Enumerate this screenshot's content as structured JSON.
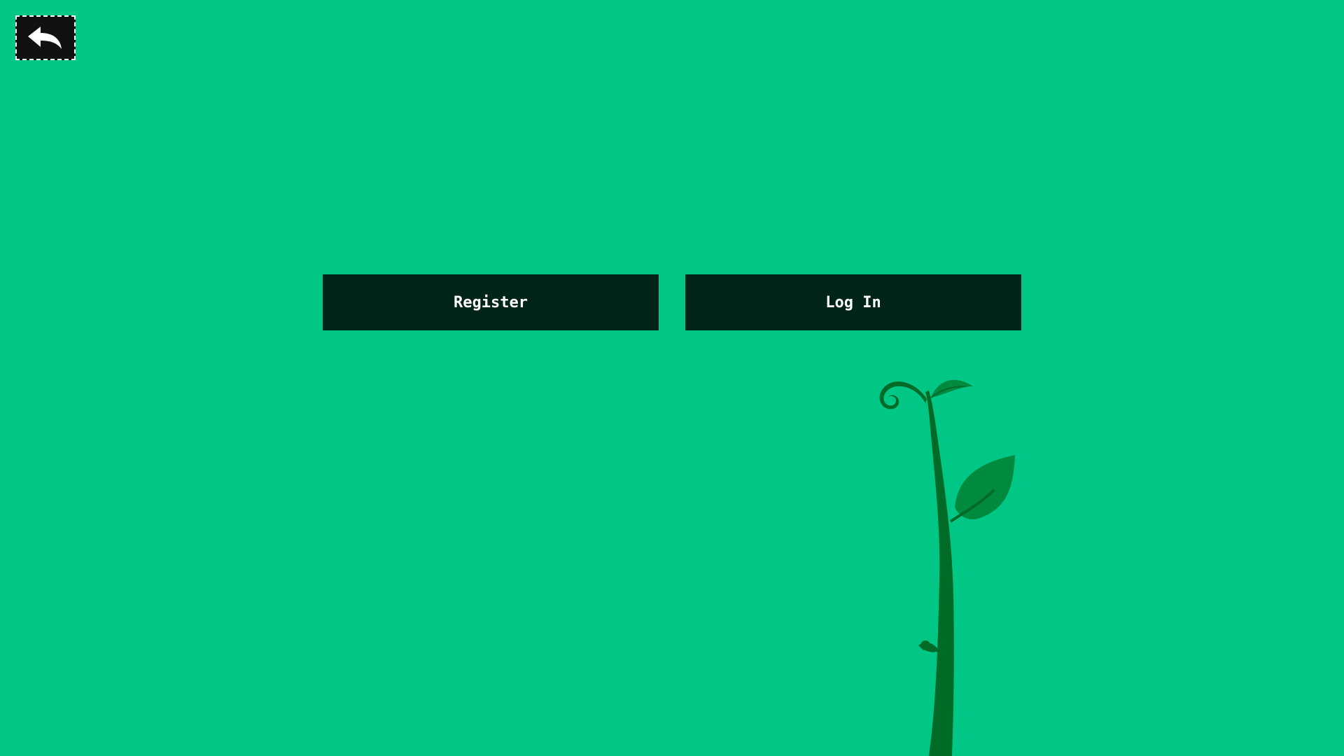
{
  "nav": {
    "back_icon": "back-arrow-icon"
  },
  "auth": {
    "register_label": "Register",
    "login_label": "Log In"
  },
  "decor": {
    "plant_icon": "sprout-illustration"
  },
  "colors": {
    "background": "#00c785",
    "button": "#00231a",
    "button_text": "#ffffff",
    "plant_dark": "#006b27",
    "plant_leaf": "#008a3f"
  }
}
